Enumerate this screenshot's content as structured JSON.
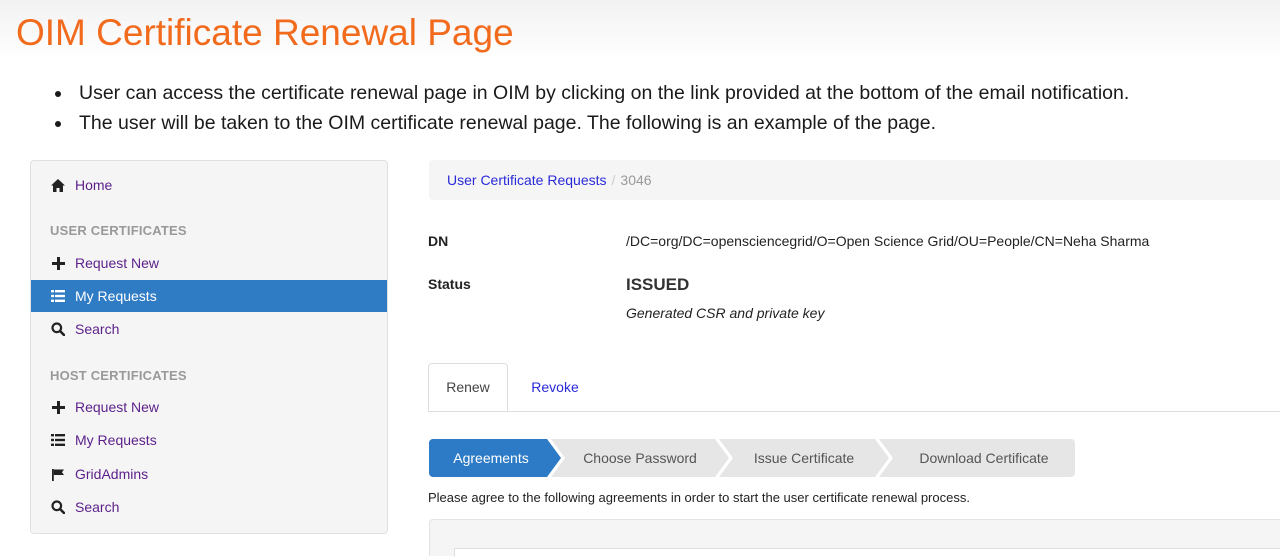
{
  "slide": {
    "title": "OIM Certificate Renewal Page",
    "bullets": [
      "User can access the certificate renewal page in OIM by clicking on the link provided at the bottom of the email notification.",
      "The user will be taken to the OIM certificate renewal page. The following is an example of the page."
    ],
    "title_color": "#f26b1d"
  },
  "sidebar": {
    "home": {
      "label": "Home",
      "icon": "home-icon"
    },
    "user_section": {
      "header": "USER CERTIFICATES",
      "items": [
        {
          "label": "Request New",
          "icon": "plus-icon"
        },
        {
          "label": "My Requests",
          "icon": "list-icon",
          "active": true
        },
        {
          "label": "Search",
          "icon": "search-icon"
        }
      ]
    },
    "host_section": {
      "header": "HOST CERTIFICATES",
      "items": [
        {
          "label": "Request New",
          "icon": "plus-icon"
        },
        {
          "label": "My Requests",
          "icon": "list-icon"
        },
        {
          "label": "GridAdmins",
          "icon": "flag-icon"
        },
        {
          "label": "Search",
          "icon": "search-icon"
        }
      ]
    },
    "active_color": "#2f7bc4",
    "link_color": "#5b1f8a"
  },
  "breadcrumb": {
    "parent": "User Certificate Requests",
    "separator": "/",
    "current": "3046"
  },
  "details": {
    "dn_label": "DN",
    "dn_value": "/DC=org/DC=opensciencegrid/O=Open Science Grid/OU=People/CN=Neha Sharma",
    "status_label": "Status",
    "status_value": "ISSUED",
    "status_note": "Generated CSR and private key"
  },
  "tabs": [
    {
      "label": "Renew",
      "active": true
    },
    {
      "label": "Revoke",
      "active": false
    }
  ],
  "steps": [
    {
      "label": "Agreements",
      "active": true
    },
    {
      "label": "Choose Password",
      "active": false
    },
    {
      "label": "Issue Certificate",
      "active": false
    },
    {
      "label": "Download Certificate",
      "active": false
    }
  ],
  "agreement_prompt": "Please agree to the following agreements in order to start the user certificate renewal process."
}
